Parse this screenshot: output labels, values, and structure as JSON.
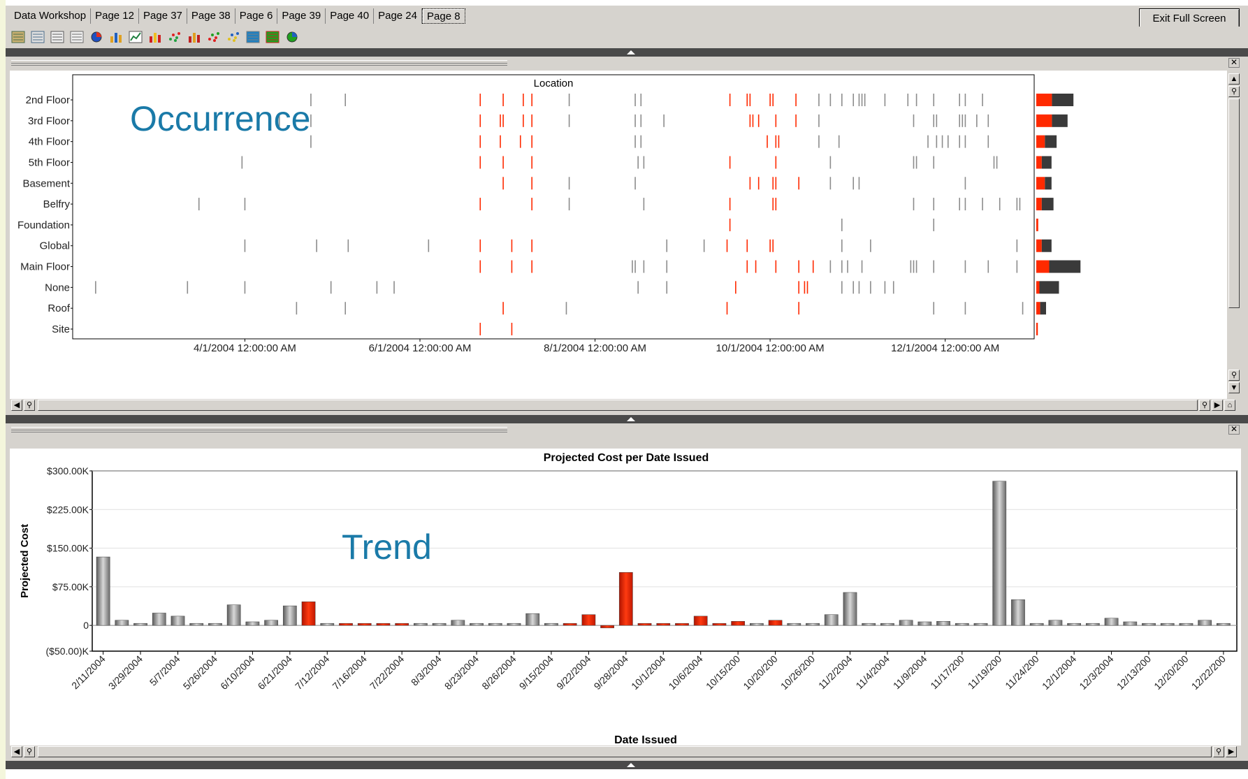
{
  "tabs": [
    {
      "label": "Data Workshop",
      "active": false
    },
    {
      "label": "Page 12",
      "active": false
    },
    {
      "label": "Page 37",
      "active": false
    },
    {
      "label": "Page 38",
      "active": false
    },
    {
      "label": "Page 6",
      "active": false
    },
    {
      "label": "Page 39",
      "active": false
    },
    {
      "label": "Page 40",
      "active": false
    },
    {
      "label": "Page 24",
      "active": false
    },
    {
      "label": "Page 8",
      "active": true
    }
  ],
  "exit_label": "Exit Full Screen",
  "toolbar_icons": [
    "table-icon",
    "grid-icon",
    "list-icon",
    "report-icon",
    "pie-chart-icon",
    "bar-chart-icon",
    "line-chart-icon",
    "column-chart-icon",
    "scatter-icon",
    "stacked-bar-icon",
    "bubble-icon",
    "cluster-icon",
    "heatmap-icon",
    "treemap-icon",
    "globe-icon"
  ],
  "overlays": {
    "occurrence": "Occurrence",
    "trend": "Trend"
  },
  "colors": {
    "highlight": "#ff2a00",
    "normal": "#8c8c8c",
    "dark": "#3a3a3a",
    "overlay_text": "#1a7aa8"
  },
  "chart_data": [
    {
      "type": "scatter",
      "title": "Location",
      "categories": [
        "2nd Floor",
        "3rd Floor",
        "4th Floor",
        "5th Floor",
        "Basement",
        "Belfry",
        "Foundation",
        "Global",
        "Main Floor",
        "None",
        "Roof",
        "Site"
      ],
      "x_tick_labels": [
        "4/1/2004 12:00:00 AM",
        "6/1/2004 12:00:00 AM",
        "8/1/2004 12:00:00 AM",
        "10/1/2004 12:00:00 AM",
        "12/1/2004 12:00:00 AM"
      ],
      "x_range": [
        "2/1/2004",
        "1/1/2005"
      ],
      "grid": false,
      "events": [
        [
          [
            "4/24",
            0
          ],
          [
            "5/6",
            0
          ],
          [
            "6/22",
            1
          ],
          [
            "6/30",
            1
          ],
          [
            "7/7",
            1
          ],
          [
            "7/10",
            1
          ],
          [
            "7/23",
            0
          ],
          [
            "8/15",
            0
          ],
          [
            "8/17",
            0
          ],
          [
            "9/17",
            1
          ],
          [
            "9/23",
            1
          ],
          [
            "9/24",
            1
          ],
          [
            "10/1",
            1
          ],
          [
            "10/2",
            1
          ],
          [
            "10/10",
            1
          ],
          [
            "10/18",
            0
          ],
          [
            "10/22",
            0
          ],
          [
            "10/26",
            0
          ],
          [
            "10/30",
            0
          ],
          [
            "11/1",
            0
          ],
          [
            "11/2",
            0
          ],
          [
            "11/3",
            0
          ],
          [
            "11/10",
            0
          ],
          [
            "11/18",
            0
          ],
          [
            "11/21",
            0
          ],
          [
            "11/27",
            0
          ],
          [
            "12/6",
            0
          ],
          [
            "12/8",
            0
          ],
          [
            "12/14",
            0
          ]
        ],
        [
          [
            "4/13",
            0
          ],
          [
            "4/24",
            0
          ],
          [
            "6/22",
            1
          ],
          [
            "6/29",
            1
          ],
          [
            "6/30",
            1
          ],
          [
            "7/7",
            1
          ],
          [
            "7/10",
            1
          ],
          [
            "7/23",
            0
          ],
          [
            "8/15",
            0
          ],
          [
            "8/17",
            0
          ],
          [
            "8/25",
            0
          ],
          [
            "9/24",
            1
          ],
          [
            "9/25",
            1
          ],
          [
            "9/27",
            1
          ],
          [
            "10/3",
            1
          ],
          [
            "10/10",
            1
          ],
          [
            "10/18",
            0
          ],
          [
            "11/20",
            0
          ],
          [
            "11/27",
            0
          ],
          [
            "11/28",
            0
          ],
          [
            "12/6",
            0
          ],
          [
            "12/7",
            0
          ],
          [
            "12/8",
            0
          ],
          [
            "12/12",
            0
          ],
          [
            "12/16",
            0
          ]
        ],
        [
          [
            "4/24",
            0
          ],
          [
            "6/22",
            1
          ],
          [
            "6/29",
            1
          ],
          [
            "7/6",
            1
          ],
          [
            "7/10",
            1
          ],
          [
            "8/15",
            0
          ],
          [
            "8/17",
            0
          ],
          [
            "9/30",
            1
          ],
          [
            "10/3",
            1
          ],
          [
            "10/4",
            1
          ],
          [
            "10/18",
            0
          ],
          [
            "10/25",
            0
          ],
          [
            "11/25",
            0
          ],
          [
            "11/28",
            0
          ],
          [
            "11/30",
            0
          ],
          [
            "12/2",
            0
          ],
          [
            "12/6",
            0
          ],
          [
            "12/8",
            0
          ],
          [
            "12/16",
            0
          ]
        ],
        [
          [
            "3/31",
            0
          ],
          [
            "6/22",
            1
          ],
          [
            "6/30",
            1
          ],
          [
            "7/10",
            1
          ],
          [
            "8/16",
            0
          ],
          [
            "8/18",
            0
          ],
          [
            "9/17",
            1
          ],
          [
            "10/3",
            1
          ],
          [
            "10/22",
            0
          ],
          [
            "11/20",
            0
          ],
          [
            "11/21",
            0
          ],
          [
            "11/27",
            0
          ],
          [
            "12/18",
            0
          ],
          [
            "12/19",
            0
          ]
        ],
        [
          [
            "6/30",
            1
          ],
          [
            "7/10",
            1
          ],
          [
            "7/23",
            0
          ],
          [
            "8/15",
            0
          ],
          [
            "9/24",
            1
          ],
          [
            "9/27",
            1
          ],
          [
            "10/2",
            1
          ],
          [
            "10/3",
            1
          ],
          [
            "10/11",
            1
          ],
          [
            "10/22",
            0
          ],
          [
            "10/30",
            0
          ],
          [
            "11/1",
            0
          ],
          [
            "12/8",
            0
          ]
        ],
        [
          [
            "3/16",
            0
          ],
          [
            "4/1",
            0
          ],
          [
            "6/22",
            1
          ],
          [
            "7/10",
            1
          ],
          [
            "7/23",
            0
          ],
          [
            "8/18",
            0
          ],
          [
            "9/17",
            1
          ],
          [
            "10/2",
            1
          ],
          [
            "10/3",
            1
          ],
          [
            "11/20",
            0
          ],
          [
            "11/27",
            0
          ],
          [
            "12/6",
            0
          ],
          [
            "12/8",
            0
          ],
          [
            "12/14",
            0
          ],
          [
            "12/20",
            0
          ],
          [
            "12/26",
            0
          ],
          [
            "12/27",
            0
          ]
        ],
        [
          [
            "9/17",
            1
          ],
          [
            "10/26",
            0
          ],
          [
            "11/27",
            0
          ]
        ],
        [
          [
            "4/1",
            0
          ],
          [
            "4/26",
            0
          ],
          [
            "5/7",
            0
          ],
          [
            "6/4",
            0
          ],
          [
            "6/22",
            1
          ],
          [
            "7/3",
            1
          ],
          [
            "7/10",
            1
          ],
          [
            "8/26",
            0
          ],
          [
            "9/8",
            0
          ],
          [
            "9/16",
            1
          ],
          [
            "9/23",
            1
          ],
          [
            "10/1",
            1
          ],
          [
            "10/2",
            1
          ],
          [
            "10/26",
            0
          ],
          [
            "11/5",
            0
          ],
          [
            "12/26",
            0
          ]
        ],
        [
          [
            "6/22",
            1
          ],
          [
            "7/3",
            1
          ],
          [
            "7/10",
            1
          ],
          [
            "8/14",
            0
          ],
          [
            "8/15",
            0
          ],
          [
            "8/18",
            0
          ],
          [
            "8/26",
            0
          ],
          [
            "9/23",
            1
          ],
          [
            "9/26",
            1
          ],
          [
            "10/3",
            1
          ],
          [
            "10/11",
            1
          ],
          [
            "10/16",
            1
          ],
          [
            "10/22",
            0
          ],
          [
            "10/26",
            0
          ],
          [
            "10/28",
            0
          ],
          [
            "11/2",
            0
          ],
          [
            "11/19",
            0
          ],
          [
            "11/20",
            0
          ],
          [
            "11/21",
            0
          ],
          [
            "11/27",
            0
          ],
          [
            "12/8",
            0
          ],
          [
            "12/16",
            0
          ],
          [
            "12/26",
            0
          ]
        ],
        [
          [
            "2/9",
            0
          ],
          [
            "3/12",
            0
          ],
          [
            "4/1",
            0
          ],
          [
            "5/1",
            0
          ],
          [
            "5/17",
            0
          ],
          [
            "5/23",
            0
          ],
          [
            "8/16",
            0
          ],
          [
            "8/26",
            0
          ],
          [
            "9/19",
            1
          ],
          [
            "10/11",
            1
          ],
          [
            "10/13",
            1
          ],
          [
            "10/14",
            1
          ],
          [
            "10/26",
            0
          ],
          [
            "10/30",
            0
          ],
          [
            "11/1",
            0
          ],
          [
            "11/5",
            0
          ],
          [
            "11/10",
            0
          ],
          [
            "11/13",
            0
          ]
        ],
        [
          [
            "4/19",
            0
          ],
          [
            "5/6",
            0
          ],
          [
            "6/30",
            1
          ],
          [
            "7/22",
            0
          ],
          [
            "9/16",
            1
          ],
          [
            "10/11",
            1
          ],
          [
            "11/27",
            0
          ],
          [
            "12/8",
            0
          ],
          [
            "12/28",
            0
          ]
        ],
        [
          [
            "6/22",
            1
          ],
          [
            "7/3",
            1
          ]
        ]
      ],
      "summary_bars": [
        {
          "red": 0.4,
          "dark": 0.55
        },
        {
          "red": 0.4,
          "dark": 0.4
        },
        {
          "red": 0.22,
          "dark": 0.3
        },
        {
          "red": 0.14,
          "dark": 0.25
        },
        {
          "red": 0.22,
          "dark": 0.17
        },
        {
          "red": 0.14,
          "dark": 0.3
        },
        {
          "red": 0.05,
          "dark": 0.0
        },
        {
          "red": 0.14,
          "dark": 0.25
        },
        {
          "red": 0.33,
          "dark": 0.8
        },
        {
          "red": 0.08,
          "dark": 0.5
        },
        {
          "red": 0.1,
          "dark": 0.15
        },
        {
          "red": 0.04,
          "dark": 0.0
        }
      ]
    },
    {
      "type": "bar",
      "title": "Projected Cost per  Date  Issued",
      "xlabel": "Date  Issued",
      "ylabel": "Projected Cost",
      "y_ticks": [
        "$300.00K",
        "$225.00K",
        "$150.00K",
        "$75.00K",
        "0",
        "($50.00)K"
      ],
      "ylim": [
        -50,
        300
      ],
      "unit": "$K",
      "x_tick_labels": [
        "2/11/2004",
        "3/29/2004",
        "5/7/2004",
        "5/26/2004",
        "6/10/2004",
        "6/21/2004",
        "7/12/2004",
        "7/16/2004",
        "7/22/2004",
        "8/3/2004",
        "8/23/2004",
        "8/26/2004",
        "9/15/2004",
        "9/22/2004",
        "9/28/2004",
        "10/1/2004",
        "10/6/2004",
        "10/15/200",
        "10/20/200",
        "10/26/200",
        "11/2/2004",
        "11/4/2004",
        "11/9/2004",
        "11/17/200",
        "11/19/200",
        "11/24/200",
        "12/1/2004",
        "12/3/2004",
        "12/13/200",
        "12/20/200",
        "12/22/200"
      ],
      "values": [
        133,
        10,
        4,
        24,
        18,
        4,
        4,
        40,
        7,
        10,
        38,
        46,
        4,
        4,
        4,
        4,
        4,
        4,
        4,
        10,
        4,
        4,
        4,
        23,
        4,
        4,
        21,
        -5,
        103,
        4,
        4,
        4,
        18,
        4,
        8,
        4,
        10,
        4,
        4,
        21,
        64,
        4,
        4,
        10,
        7,
        8,
        4,
        4,
        280,
        50,
        4,
        10,
        4,
        4,
        14,
        7,
        4,
        4,
        4,
        10,
        4
      ],
      "highlighted": [
        false,
        false,
        false,
        false,
        false,
        false,
        false,
        false,
        false,
        false,
        false,
        true,
        false,
        true,
        true,
        true,
        true,
        false,
        false,
        false,
        false,
        false,
        false,
        false,
        false,
        true,
        true,
        true,
        true,
        true,
        true,
        true,
        true,
        true,
        true,
        false,
        true,
        false,
        false,
        false,
        false,
        false,
        false,
        false,
        false,
        false,
        false,
        false,
        false,
        false,
        false,
        false,
        false,
        false,
        false,
        false,
        false,
        false,
        false,
        false,
        false
      ]
    }
  ]
}
